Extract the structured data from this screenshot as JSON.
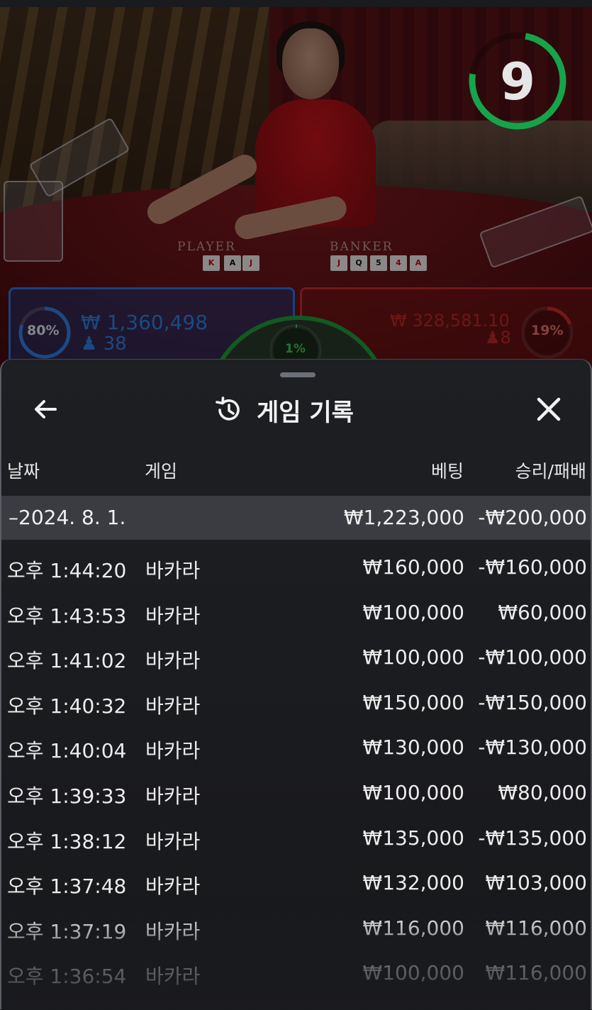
{
  "game": {
    "timer": "9",
    "table_labels": {
      "player": "PLAYER",
      "banker": "BANKER"
    },
    "player": {
      "pct": "80%",
      "amount": "₩ 1,360,498",
      "count": "38",
      "progress": 0.8
    },
    "banker": {
      "pct": "19%",
      "amount": "₩ 328,581.10",
      "count": "8",
      "progress": 0.19
    },
    "tie": {
      "pct": "1%",
      "progress": 0.01
    },
    "colors": {
      "player": "#2f7fe0",
      "banker": "#c72a2a",
      "tie": "#1e9b3a",
      "timer": "#16a34a"
    }
  },
  "history": {
    "title": "게임 기록",
    "icons": {
      "back": "arrow-left-icon",
      "history": "history-icon",
      "close": "close-icon"
    },
    "columns": {
      "date": "날짜",
      "game": "게임",
      "bet": "베팅",
      "result": "승리/패배"
    },
    "day": {
      "date": "–2024. 8. 1.",
      "bet": "₩1,223,000",
      "result": "-₩200,000"
    },
    "rows": [
      {
        "time": "오후 1:44:20",
        "game": "바카라",
        "bet": "₩160,000",
        "result": "-₩160,000"
      },
      {
        "time": "오후 1:43:53",
        "game": "바카라",
        "bet": "₩100,000",
        "result": "₩60,000"
      },
      {
        "time": "오후 1:41:02",
        "game": "바카라",
        "bet": "₩100,000",
        "result": "-₩100,000"
      },
      {
        "time": "오후 1:40:32",
        "game": "바카라",
        "bet": "₩150,000",
        "result": "-₩150,000"
      },
      {
        "time": "오후 1:40:04",
        "game": "바카라",
        "bet": "₩130,000",
        "result": "-₩130,000"
      },
      {
        "time": "오후 1:39:33",
        "game": "바카라",
        "bet": "₩100,000",
        "result": "₩80,000"
      },
      {
        "time": "오후 1:38:12",
        "game": "바카라",
        "bet": "₩135,000",
        "result": "-₩135,000"
      },
      {
        "time": "오후 1:37:48",
        "game": "바카라",
        "bet": "₩132,000",
        "result": "₩103,000"
      },
      {
        "time": "오후 1:37:19",
        "game": "바카라",
        "bet": "₩116,000",
        "result": "₩116,000"
      },
      {
        "time": "오후 1:36:54",
        "game": "바카라",
        "bet": "₩100,000",
        "result": "₩116,000"
      }
    ]
  }
}
